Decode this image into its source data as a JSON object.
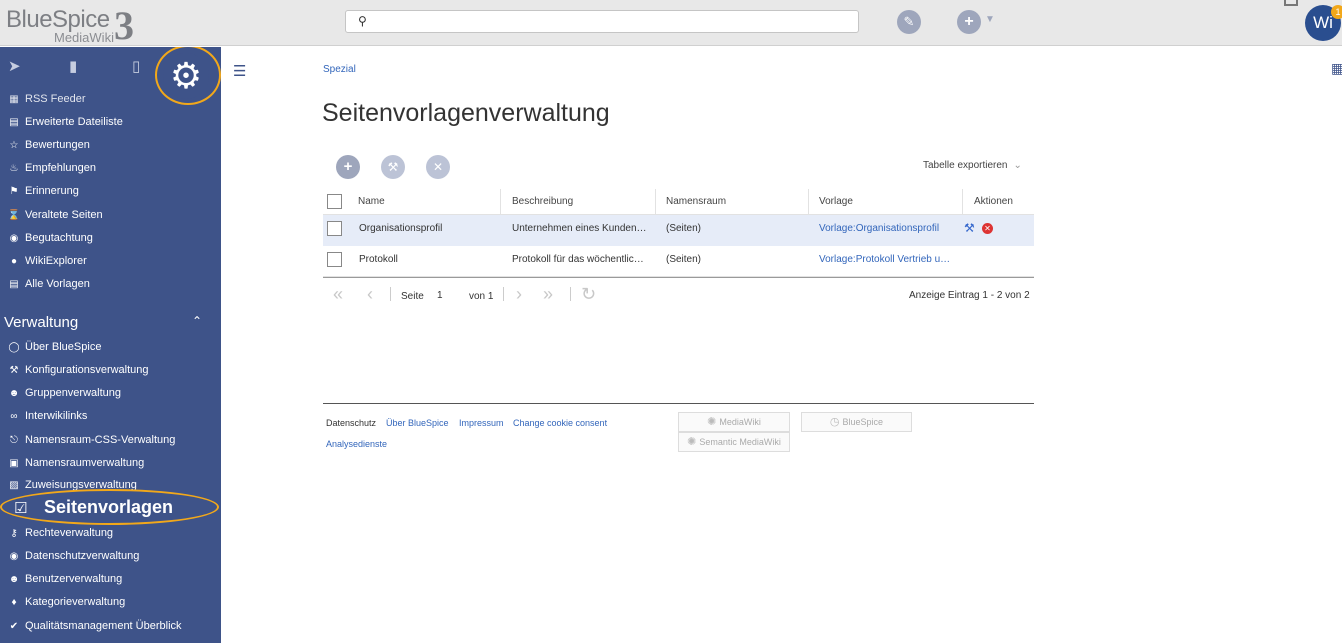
{
  "header": {
    "logo_brand": "BlueSpice",
    "logo_version": "3",
    "logo_sub": "MediaWiki",
    "search_placeholder": "",
    "avatar_text": "Wi",
    "notification_count": "1"
  },
  "sidebar": {
    "items": [
      {
        "label": "RSS Feeder",
        "icon": "rss-icon"
      },
      {
        "label": "Erweiterte Dateiliste",
        "icon": "list-icon"
      },
      {
        "label": "Bewertungen",
        "icon": "star-icon"
      },
      {
        "label": "Empfehlungen",
        "icon": "flame-icon"
      },
      {
        "label": "Erinnerung",
        "icon": "flag-icon"
      },
      {
        "label": "Veraltete Seiten",
        "icon": "hourglass-icon"
      },
      {
        "label": "Begutachtung",
        "icon": "eye-icon"
      },
      {
        "label": "WikiExplorer",
        "icon": "globe-icon"
      },
      {
        "label": "Alle Vorlagen",
        "icon": "list-icon"
      }
    ],
    "section_title": "Verwaltung",
    "admin_items": [
      {
        "label": "Über BlueSpice",
        "icon": "info-icon"
      },
      {
        "label": "Konfigurationsverwaltung",
        "icon": "wrench-icon"
      },
      {
        "label": "Gruppenverwaltung",
        "icon": "group-icon"
      },
      {
        "label": "Interwikilinks",
        "icon": "link-icon"
      },
      {
        "label": "Namensraum-CSS-Verwaltung",
        "icon": "paint-roller-icon"
      },
      {
        "label": "Namensraumverwaltung",
        "icon": "drive-icon"
      },
      {
        "label": "Zuweisungsverwaltung",
        "icon": "person-card-icon"
      },
      {
        "label": "Seitenvorlagen",
        "icon": "checkbox-icon"
      },
      {
        "label": "Rechteverwaltung",
        "icon": "key-icon"
      },
      {
        "label": "Datenschutzverwaltung",
        "icon": "eye-icon"
      },
      {
        "label": "Benutzerverwaltung",
        "icon": "user-icon"
      },
      {
        "label": "Kategorieverwaltung",
        "icon": "tag-icon"
      },
      {
        "label": "Qualitätsmanagement Überblick",
        "icon": "check-circle-icon"
      }
    ]
  },
  "main": {
    "breadcrumb": "Spezial",
    "title": "Seitenvorlagenverwaltung",
    "export_label": "Tabelle exportieren",
    "table": {
      "columns": [
        "Name",
        "Beschreibung",
        "Namensraum",
        "Vorlage",
        "Aktionen"
      ],
      "rows": [
        {
          "name": "Organisationsprofil",
          "description": "Unternehmen eines Kunden…",
          "namespace": "(Seiten)",
          "template": "Vorlage:Organisationsprofil"
        },
        {
          "name": "Protokoll",
          "description": "Protokoll für das wöchentlic…",
          "namespace": "(Seiten)",
          "template": "Vorlage:Protokoll Vertrieb u…"
        }
      ]
    },
    "pager": {
      "page_label": "Seite",
      "page_value": "1",
      "of_label": "von 1",
      "info": "Anzeige Eintrag 1 - 2 von 2"
    }
  },
  "footer": {
    "links": [
      "Datenschutz",
      "Über BlueSpice",
      "Impressum",
      "Change cookie consent",
      "Analysedienste"
    ],
    "badges": [
      "MediaWiki",
      "BlueSpice",
      "Semantic MediaWiki"
    ]
  },
  "colors": {
    "sidebar_bg": "#3e5389",
    "highlight_ring": "#f2a81a",
    "link": "#3366bb"
  }
}
